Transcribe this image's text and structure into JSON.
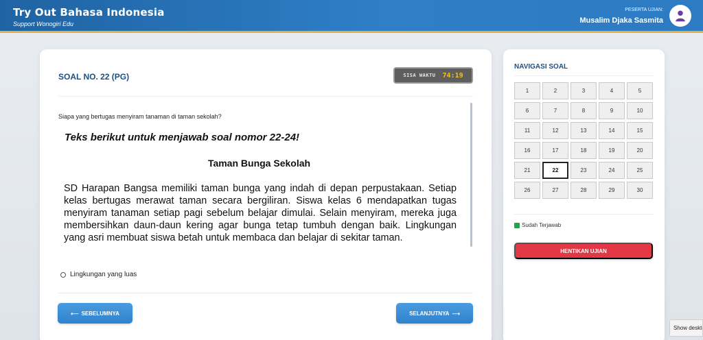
{
  "header": {
    "title": "Try Out Bahasa Indonesia",
    "subtitle": "Support Wonogiri Edu",
    "user_caption": "PESERTA UJIAN:",
    "user_name": "Musalim Djaka Sasmita",
    "avatar_icon": "user-icon"
  },
  "question": {
    "title": "SOAL NO. 22 (PG)",
    "timer_label": "SISA WAKTU",
    "timer_value": "74:19",
    "text": "Siapa yang bertugas menyiram tanaman di taman sekolah?",
    "passage_heading": "Teks berikut untuk menjawab soal nomor 22-24!",
    "passage_title": "Taman Bunga Sekolah",
    "passage_body": "SD Harapan Bangsa memiliki taman bunga yang indah di depan perpustakaan. Setiap kelas bertugas merawat taman secara bergiliran. Siswa kelas 6 mendapatkan tugas menyiram tanaman setiap pagi sebelum belajar dimulai. Selain menyiram, mereka juga membersihkan daun-daun kering agar bunga tetap tumbuh dengan baik. Lingkungan yang asri membuat siswa betah untuk membaca dan belajar di sekitar taman.",
    "option_label": "Lingkungan yang luas",
    "prev_label": "SEBELUMNYA",
    "next_label": "SELANJUTNYA",
    "prev_icon": "arrow-left-icon",
    "next_icon": "arrow-right-icon"
  },
  "navigation": {
    "title": "NAVIGASI SOAL",
    "numbers": [
      "1",
      "2",
      "3",
      "4",
      "5",
      "6",
      "7",
      "8",
      "9",
      "10",
      "11",
      "12",
      "13",
      "14",
      "15",
      "16",
      "17",
      "18",
      "19",
      "20",
      "21",
      "22",
      "23",
      "24",
      "25",
      "26",
      "27",
      "28",
      "29",
      "30"
    ],
    "active": "22",
    "legend_label": "Sudah Terjawab",
    "legend_color": "#22a447",
    "stop_label": "HENTIKAN UJIAN",
    "stop_color": "#e23744"
  },
  "taskbar": {
    "show_desktop": "Show deskto"
  }
}
